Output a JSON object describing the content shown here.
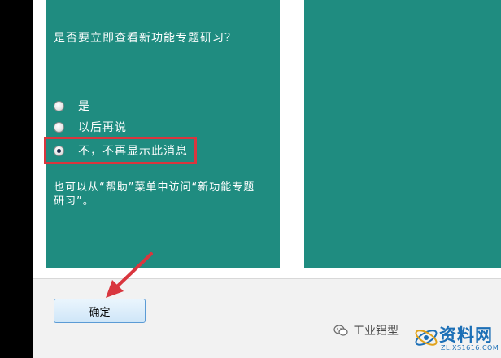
{
  "dialog": {
    "question": "是否要立即查看新功能专题研习？",
    "options": [
      {
        "label": "是",
        "checked": false
      },
      {
        "label": "以后再说",
        "checked": false
      },
      {
        "label": "不，不再显示此消息",
        "checked": true
      }
    ],
    "hint": "也可以从“帮助”菜单中访问“新功能专题研习”。",
    "ok_label": "确定"
  },
  "watermark": {
    "brand": "工业铝型",
    "site_name": "资料网",
    "site_url": "ZL.XS1616.COM"
  },
  "colors": {
    "panel": "#1f8c80",
    "annotation": "#d9363e",
    "button_border": "#5b9bd5"
  }
}
